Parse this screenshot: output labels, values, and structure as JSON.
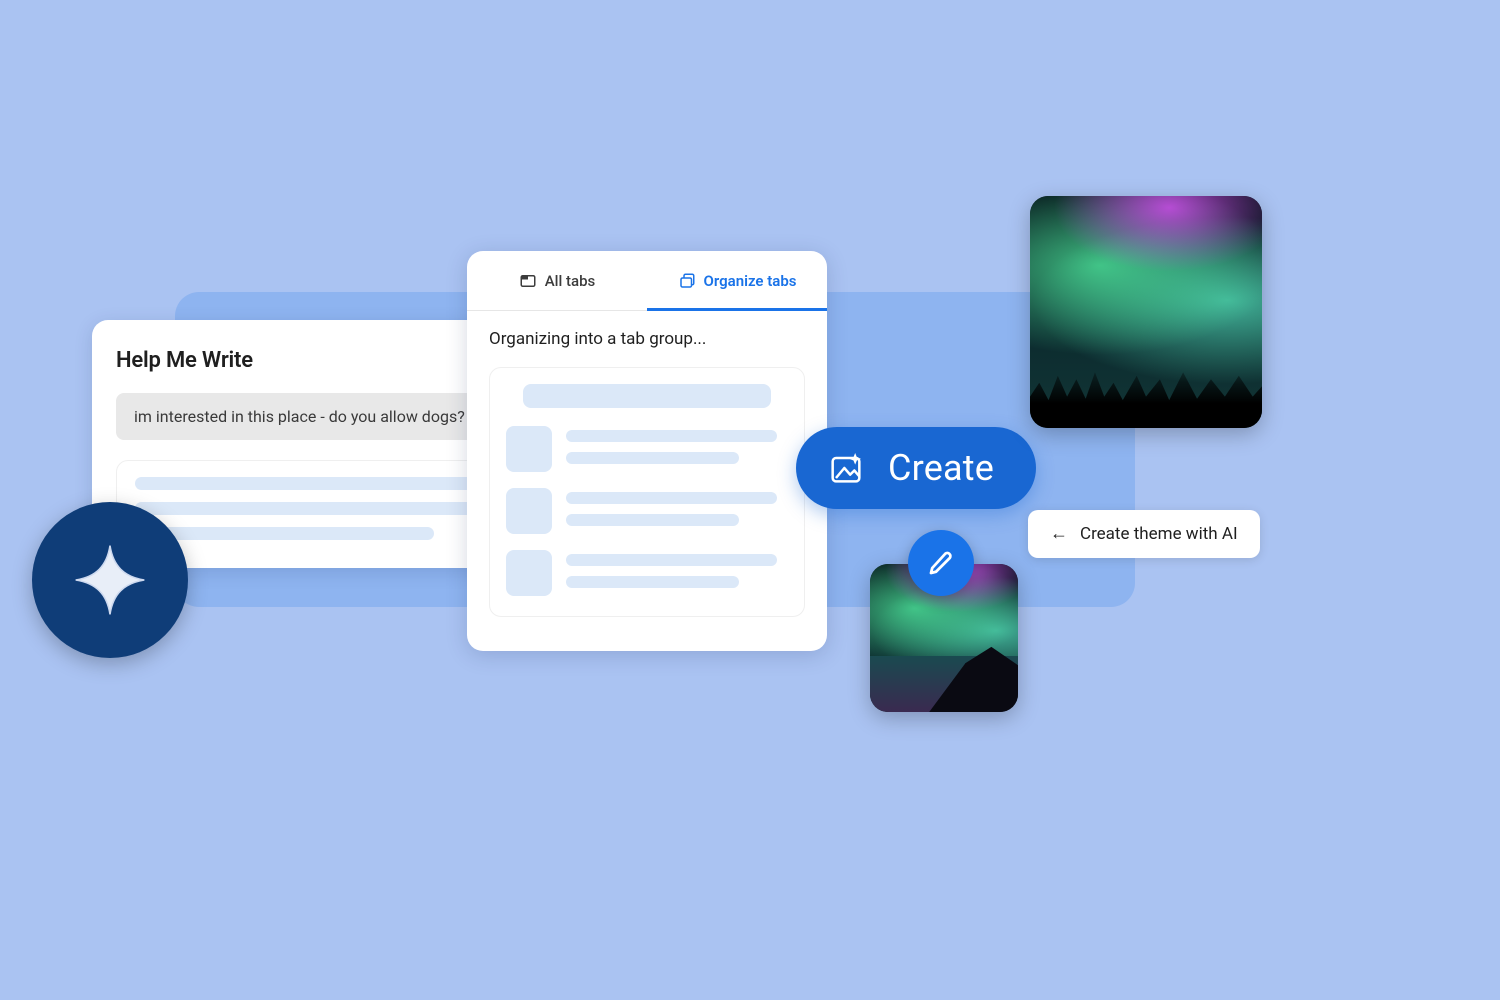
{
  "help_me_write": {
    "title": "Help Me Write",
    "input_text": "im interested in this place - do you allow dogs?"
  },
  "tabs_panel": {
    "tab_all": "All tabs",
    "tab_organize": "Organize tabs",
    "status": "Organizing into a tab group..."
  },
  "create_button": {
    "label": "Create"
  },
  "theme_chip": {
    "label": "Create theme with AI"
  }
}
